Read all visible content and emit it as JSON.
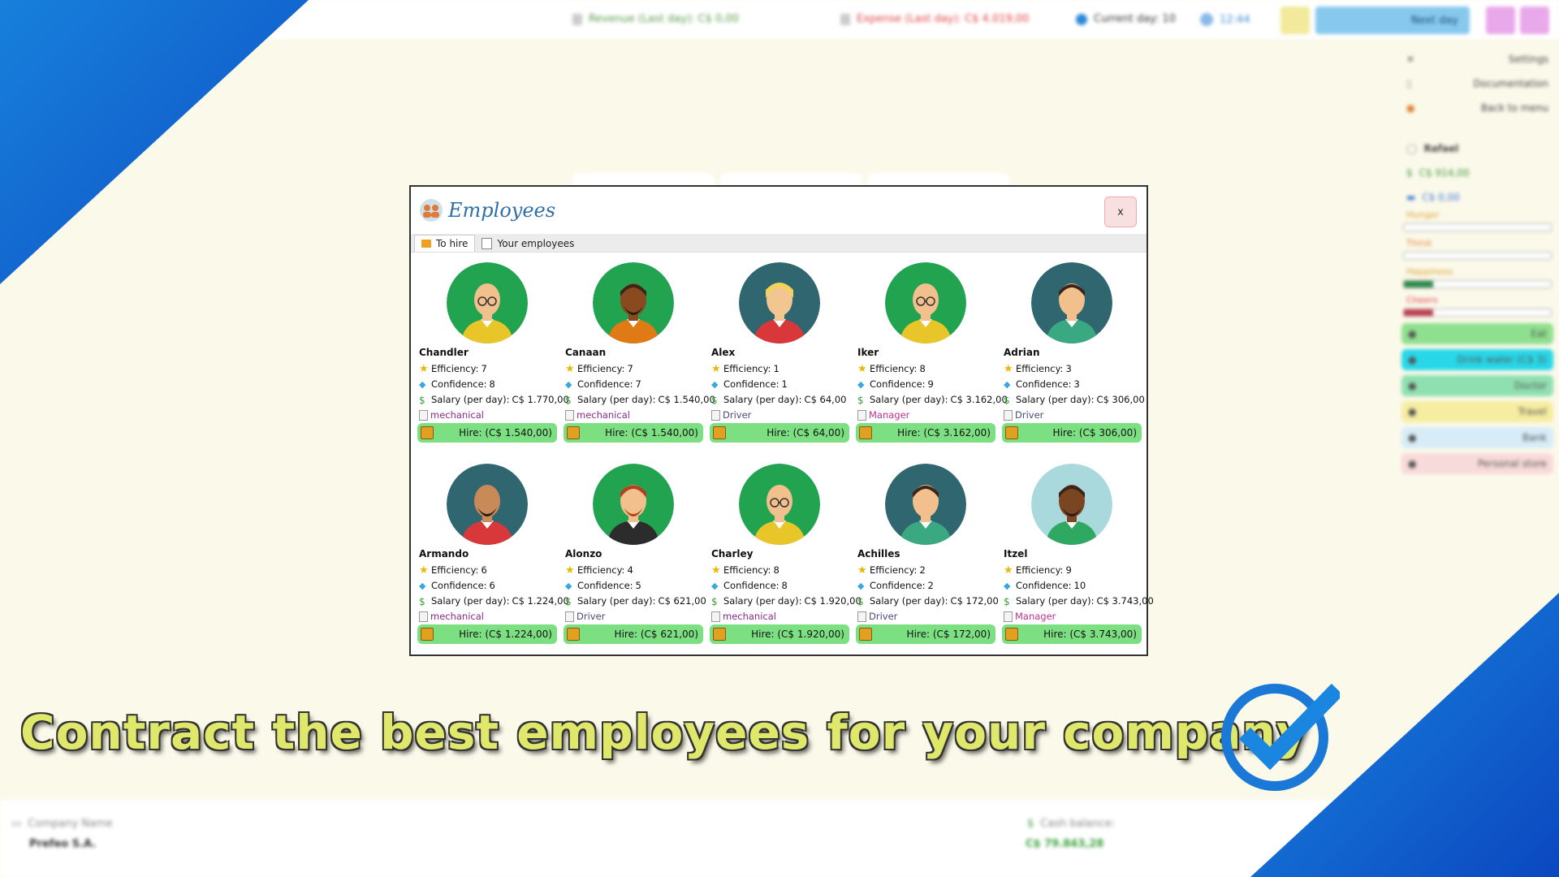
{
  "topbar": {
    "revenue": "Revenue (Last day): C$ 0,00",
    "expense": "Expense (Last day): C$ 4.019,00",
    "current_day": "Current day: 10",
    "clock": "12:44",
    "next_day": "Next day"
  },
  "right_panel": {
    "settings": "Settings",
    "documentation": "Documentation",
    "back_to_menu": "Back to menu",
    "player_name": "Rafael",
    "cash": "C$ 914,00",
    "card": "C$ 0,00",
    "hunger": "Hunger",
    "thirst": "Thirst",
    "happiness": "Happiness",
    "cheers": "Cheers",
    "happiness_level": 0.2,
    "cheers_level": 0.2,
    "buttons": [
      "Eat",
      "Drink water (C$ 3)",
      "Doctor",
      "Travel",
      "Bank",
      "Personal store"
    ]
  },
  "modal": {
    "title": "Employees",
    "close": "x",
    "tabs": [
      "To hire",
      "Your employees"
    ]
  },
  "labels": {
    "efficiency": "Efficiency:",
    "confidence": "Confidence:",
    "salary": "Salary (per day): "
  },
  "employees": [
    {
      "name": "Chandler",
      "efficiency": "7",
      "confidence": "8",
      "salary": "C$ 1.770,00",
      "role": "mechanical",
      "hire": "Hire: (C$ 1.540,00)",
      "bg": "#22a34f",
      "skin": "#f1c08c",
      "shirt": "#e8c62a",
      "hair": "bald",
      "beard": false,
      "glasses": true
    },
    {
      "name": "Canaan",
      "efficiency": "7",
      "confidence": "7",
      "salary": "C$ 1.540,00",
      "role": "mechanical",
      "hire": "Hire: (C$ 1.540,00)",
      "bg": "#22a34f",
      "skin": "#8a4a1f",
      "shirt": "#e07a15",
      "hair": "dark",
      "beard": true,
      "glasses": false
    },
    {
      "name": "Alex",
      "efficiency": "1",
      "confidence": "1",
      "salary": "C$ 64,00",
      "role": "Driver",
      "hire": "Hire: (C$ 64,00)",
      "bg": "#2f6670",
      "skin": "#f2c690",
      "shirt": "#d9383a",
      "hair": "blond",
      "beard": false,
      "glasses": false
    },
    {
      "name": "Iker",
      "efficiency": "8",
      "confidence": "9",
      "salary": "C$ 3.162,00",
      "role": "Manager",
      "hire": "Hire: (C$ 3.162,00)",
      "bg": "#22a34f",
      "skin": "#f1c08c",
      "shirt": "#e8c62a",
      "hair": "bald",
      "beard": false,
      "glasses": true
    },
    {
      "name": "Adrian",
      "efficiency": "3",
      "confidence": "3",
      "salary": "C$ 306,00",
      "role": "Driver",
      "hire": "Hire: (C$ 306,00)",
      "bg": "#2f6670",
      "skin": "#f1c08c",
      "shirt": "#3aa981",
      "hair": "dark",
      "beard": false,
      "glasses": false
    },
    {
      "name": "Armando",
      "efficiency": "6",
      "confidence": "6",
      "salary": "C$ 1.224,00",
      "role": "mechanical",
      "hire": "Hire: (C$ 1.224,00)",
      "bg": "#2f6670",
      "skin": "#c98a5a",
      "shirt": "#d9383a",
      "hair": "bald",
      "beard": true,
      "glasses": false
    },
    {
      "name": "Alonzo",
      "efficiency": "4",
      "confidence": "5",
      "salary": "C$ 621,00",
      "role": "Driver",
      "hire": "Hire: (C$ 621,00)",
      "bg": "#22a34f",
      "skin": "#f1c08c",
      "shirt": "#2c2c2c",
      "hair": "red",
      "beard": true,
      "glasses": false
    },
    {
      "name": "Charley",
      "efficiency": "8",
      "confidence": "8",
      "salary": "C$ 1.920,00",
      "role": "mechanical",
      "hire": "Hire: (C$ 1.920,00)",
      "bg": "#22a34f",
      "skin": "#f1c08c",
      "shirt": "#e8c62a",
      "hair": "bald",
      "beard": false,
      "glasses": true
    },
    {
      "name": "Achilles",
      "efficiency": "2",
      "confidence": "2",
      "salary": "C$ 172,00",
      "role": "Driver",
      "hire": "Hire: (C$ 172,00)",
      "bg": "#2f6670",
      "skin": "#f1c08c",
      "shirt": "#3aa981",
      "hair": "dark",
      "beard": false,
      "glasses": false
    },
    {
      "name": "Itzel",
      "efficiency": "9",
      "confidence": "10",
      "salary": "C$ 3.743,00",
      "role": "Manager",
      "hire": "Hire: (C$ 3.743,00)",
      "bg": "#a9d8dd",
      "skin": "#7a4521",
      "shirt": "#2fa862",
      "hair": "dark",
      "beard": true,
      "glasses": false
    }
  ],
  "bottombar": {
    "company_label": "Company Name",
    "company_value": "Prefeo S.A.",
    "cash_label": "Cash balance:",
    "cash_value": "C$ 79.843,28"
  },
  "slogan": "Contract the best employees for your company"
}
